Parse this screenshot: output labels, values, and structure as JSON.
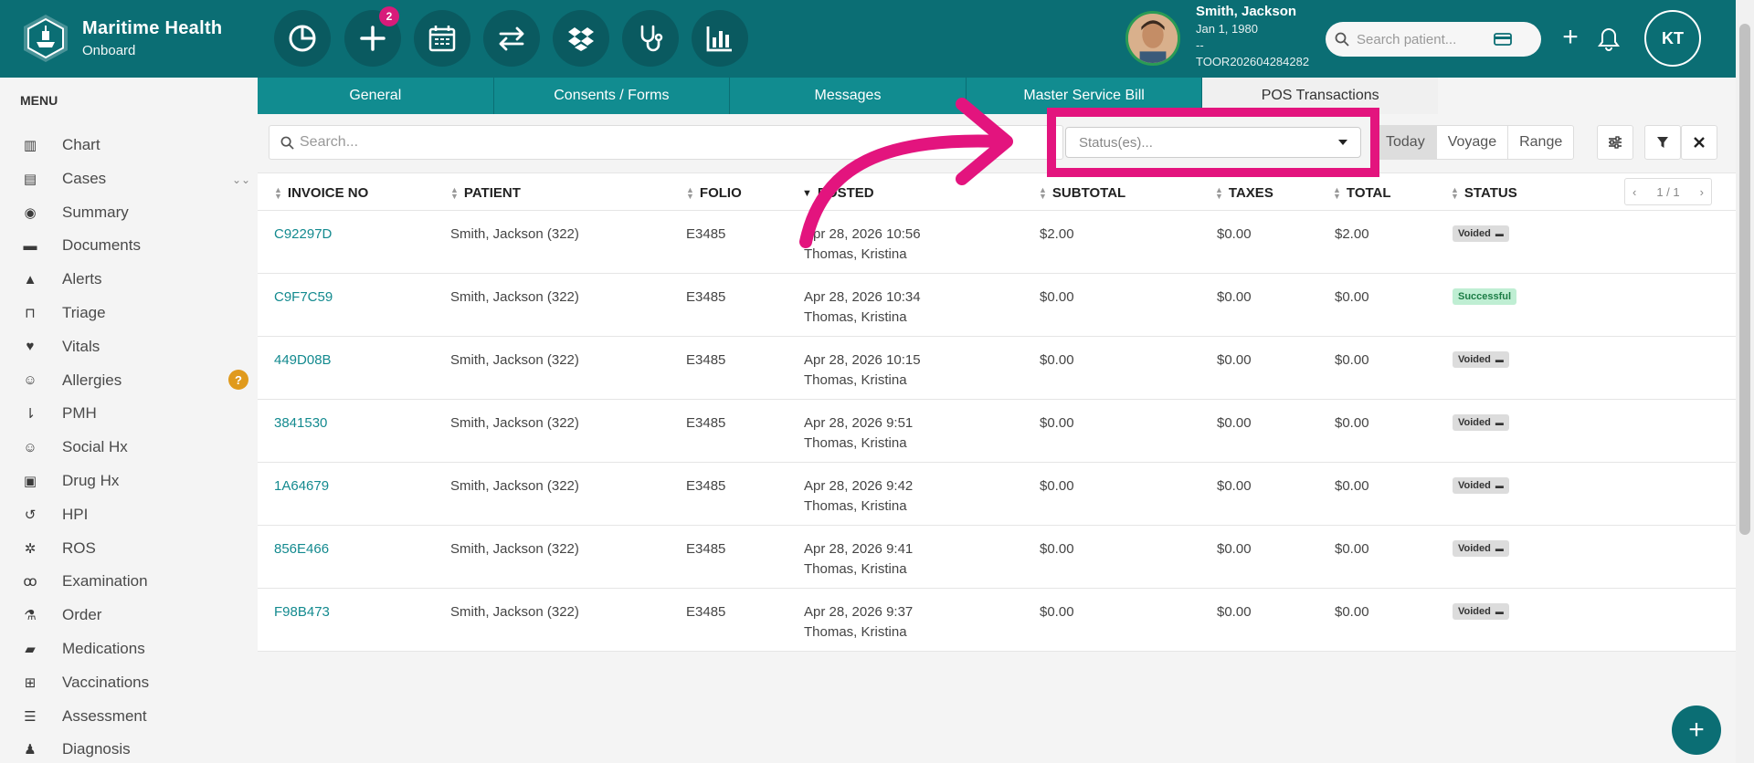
{
  "app": {
    "name": "Maritime Health",
    "subtitle": "Onboard"
  },
  "toolbar": {
    "badge_count": "2"
  },
  "patient": {
    "name": "Smith, Jackson",
    "dob": "Jan 1, 1980",
    "extra": "--",
    "id": "TOOR202604284282"
  },
  "search_patient": {
    "placeholder": "Search patient..."
  },
  "user": {
    "initials": "KT"
  },
  "sidebar": {
    "title": "MENU",
    "items": [
      {
        "label": "Chart",
        "icon": "bar-chart-icon"
      },
      {
        "label": "Cases",
        "icon": "archive-icon"
      },
      {
        "label": "Summary",
        "icon": "eye-icon"
      },
      {
        "label": "Documents",
        "icon": "folder-icon"
      },
      {
        "label": "Alerts",
        "icon": "warning-icon"
      },
      {
        "label": "Triage",
        "icon": "inbox-icon"
      },
      {
        "label": "Vitals",
        "icon": "heart-icon"
      },
      {
        "label": "Allergies",
        "icon": "smile-icon"
      },
      {
        "label": "PMH",
        "icon": "sort-icon"
      },
      {
        "label": "Social Hx",
        "icon": "smile-icon"
      },
      {
        "label": "Drug Hx",
        "icon": "medkit-icon"
      },
      {
        "label": "HPI",
        "icon": "history-icon"
      },
      {
        "label": "ROS",
        "icon": "gear-icon"
      },
      {
        "label": "Examination",
        "icon": "stethoscope-icon"
      },
      {
        "label": "Order",
        "icon": "flask-icon"
      },
      {
        "label": "Medications",
        "icon": "pill-icon"
      },
      {
        "label": "Vaccinations",
        "icon": "plus-square-icon"
      },
      {
        "label": "Assessment",
        "icon": "list-icon"
      },
      {
        "label": "Diagnosis",
        "icon": "user-doctor-icon"
      }
    ],
    "allergies_badge": "?"
  },
  "tabs": [
    {
      "label": "General"
    },
    {
      "label": "Consents / Forms"
    },
    {
      "label": "Messages"
    },
    {
      "label": "Master Service Bill"
    },
    {
      "label": "POS Transactions"
    }
  ],
  "filters": {
    "search_placeholder": "Search...",
    "status_placeholder": "Status(es)...",
    "segments": [
      "Today",
      "Voyage",
      "Range"
    ]
  },
  "table": {
    "headers": [
      "INVOICE NO",
      "PATIENT",
      "FOLIO",
      "POSTED",
      "SUBTOTAL",
      "TAXES",
      "TOTAL",
      "STATUS"
    ],
    "pager": "1 / 1",
    "rows": [
      {
        "invoice": "C92297D",
        "patient": "Smith, Jackson (322)",
        "folio": "E3485",
        "posted": "Apr 28, 2026 10:56",
        "by": "Thomas, Kristina",
        "subtotal": "$2.00",
        "taxes": "$0.00",
        "total": "$2.00",
        "status": "Voided"
      },
      {
        "invoice": "C9F7C59",
        "patient": "Smith, Jackson (322)",
        "folio": "E3485",
        "posted": "Apr 28, 2026 10:34",
        "by": "Thomas, Kristina",
        "subtotal": "$0.00",
        "taxes": "$0.00",
        "total": "$0.00",
        "status": "Successful"
      },
      {
        "invoice": "449D08B",
        "patient": "Smith, Jackson (322)",
        "folio": "E3485",
        "posted": "Apr 28, 2026 10:15",
        "by": "Thomas, Kristina",
        "subtotal": "$0.00",
        "taxes": "$0.00",
        "total": "$0.00",
        "status": "Voided"
      },
      {
        "invoice": "3841530",
        "patient": "Smith, Jackson (322)",
        "folio": "E3485",
        "posted": "Apr 28, 2026 9:51",
        "by": "Thomas, Kristina",
        "subtotal": "$0.00",
        "taxes": "$0.00",
        "total": "$0.00",
        "status": "Voided"
      },
      {
        "invoice": "1A64679",
        "patient": "Smith, Jackson (322)",
        "folio": "E3485",
        "posted": "Apr 28, 2026 9:42",
        "by": "Thomas, Kristina",
        "subtotal": "$0.00",
        "taxes": "$0.00",
        "total": "$0.00",
        "status": "Voided"
      },
      {
        "invoice": "856E466",
        "patient": "Smith, Jackson (322)",
        "folio": "E3485",
        "posted": "Apr 28, 2026 9:41",
        "by": "Thomas, Kristina",
        "subtotal": "$0.00",
        "taxes": "$0.00",
        "total": "$0.00",
        "status": "Voided"
      },
      {
        "invoice": "F98B473",
        "patient": "Smith, Jackson (322)",
        "folio": "E3485",
        "posted": "Apr 28, 2026 9:37",
        "by": "Thomas, Kristina",
        "subtotal": "$0.00",
        "taxes": "$0.00",
        "total": "$0.00",
        "status": "Voided"
      }
    ]
  },
  "colors": {
    "primary": "#0b6e74",
    "tab": "#118c90",
    "highlight": "#e3147e",
    "link": "#138a8f"
  }
}
